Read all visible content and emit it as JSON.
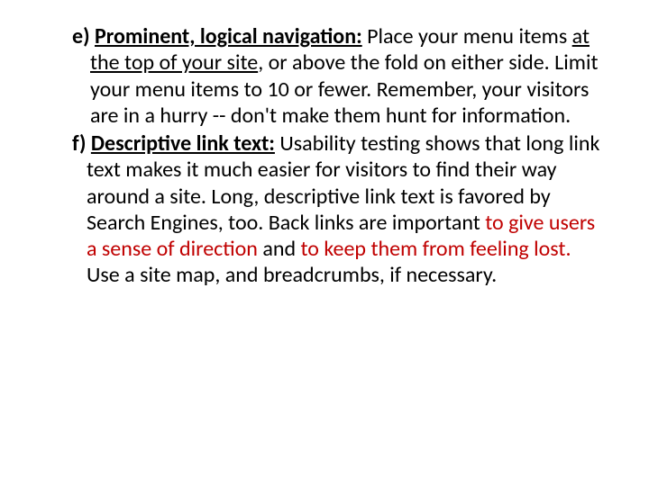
{
  "items": [
    {
      "marker": "e) ",
      "lead": "Prominent, logical navigation:",
      "seg1": " Place your menu items ",
      "seg2_u": "at the top of your site",
      "seg3": ", or above the fold on either side. Limit your menu items to 10 or fewer. Remember, your visitors are in a hurry -- don't make them hunt for information."
    },
    {
      "marker": "f) ",
      "lead": "Descriptive link text:",
      "seg1": " Usability testing shows that long link text makes it much easier for visitors to find their way around a site. Long, descriptive link text is favored by Search Engines, too. Back links are important ",
      "seg2_red": "to give users a sense of direction",
      "seg3_mid": " and ",
      "seg4_red": "to keep them from feeling lost.",
      "seg5": " Use a site map, and breadcrumbs, if necessary."
    }
  ]
}
